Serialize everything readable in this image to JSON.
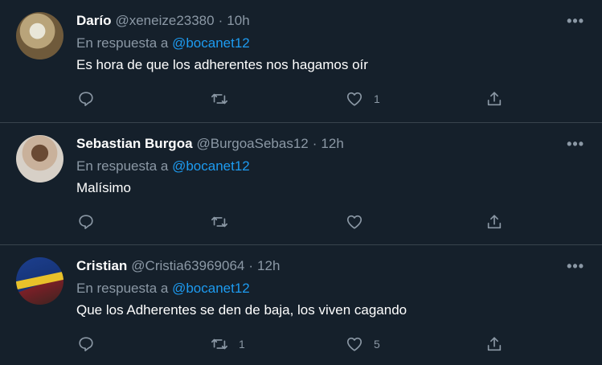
{
  "tweets": [
    {
      "name": "Darío",
      "handle": "@xeneize23380",
      "separator": "·",
      "time": "10h",
      "reply_prefix": "En respuesta a",
      "reply_to": "@bocanet12",
      "text": "Es hora de que los adherentes nos hagamos oír",
      "more": "•••",
      "replies": "",
      "retweets": "",
      "likes": "1"
    },
    {
      "name": "Sebastian Burgoa",
      "handle": "@BurgoaSebas12",
      "separator": "·",
      "time": "12h",
      "reply_prefix": "En respuesta a",
      "reply_to": "@bocanet12",
      "text": "Malísimo",
      "more": "•••",
      "replies": "",
      "retweets": "",
      "likes": ""
    },
    {
      "name": "Cristian",
      "handle": "@Cristia63969064",
      "separator": "·",
      "time": "12h",
      "reply_prefix": "En respuesta a",
      "reply_to": "@bocanet12",
      "text": "Que los Adherentes se den de baja, los viven cagando",
      "more": "•••",
      "replies": "",
      "retweets": "1",
      "likes": "5"
    }
  ],
  "icons": {
    "reply": "reply-icon",
    "retweet": "retweet-icon",
    "like": "heart-icon",
    "share": "share-icon",
    "more": "more-icon"
  },
  "colors": {
    "background": "#15202b",
    "divider": "#38444d",
    "link": "#1d9bf0",
    "muted": "#8b98a5",
    "text": "#ffffff"
  }
}
